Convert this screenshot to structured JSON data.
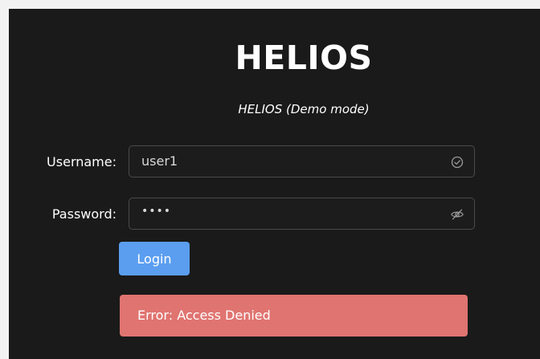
{
  "app": {
    "title": "HELIOS",
    "subtitle": "HELIOS (Demo mode)"
  },
  "login_form": {
    "username_label": "Username:",
    "username_value": "user1",
    "password_label": "Password:",
    "password_masked": "••••",
    "login_button_label": "Login"
  },
  "error": {
    "message": "Error: Access Denied"
  },
  "icons": {
    "username_status": "check-circle-icon",
    "password_visibility": "eye-off-icon"
  },
  "colors": {
    "background": "#1a1a1a",
    "primary_button": "#5b9ef0",
    "error_background": "#e07470",
    "text": "#ffffff"
  }
}
